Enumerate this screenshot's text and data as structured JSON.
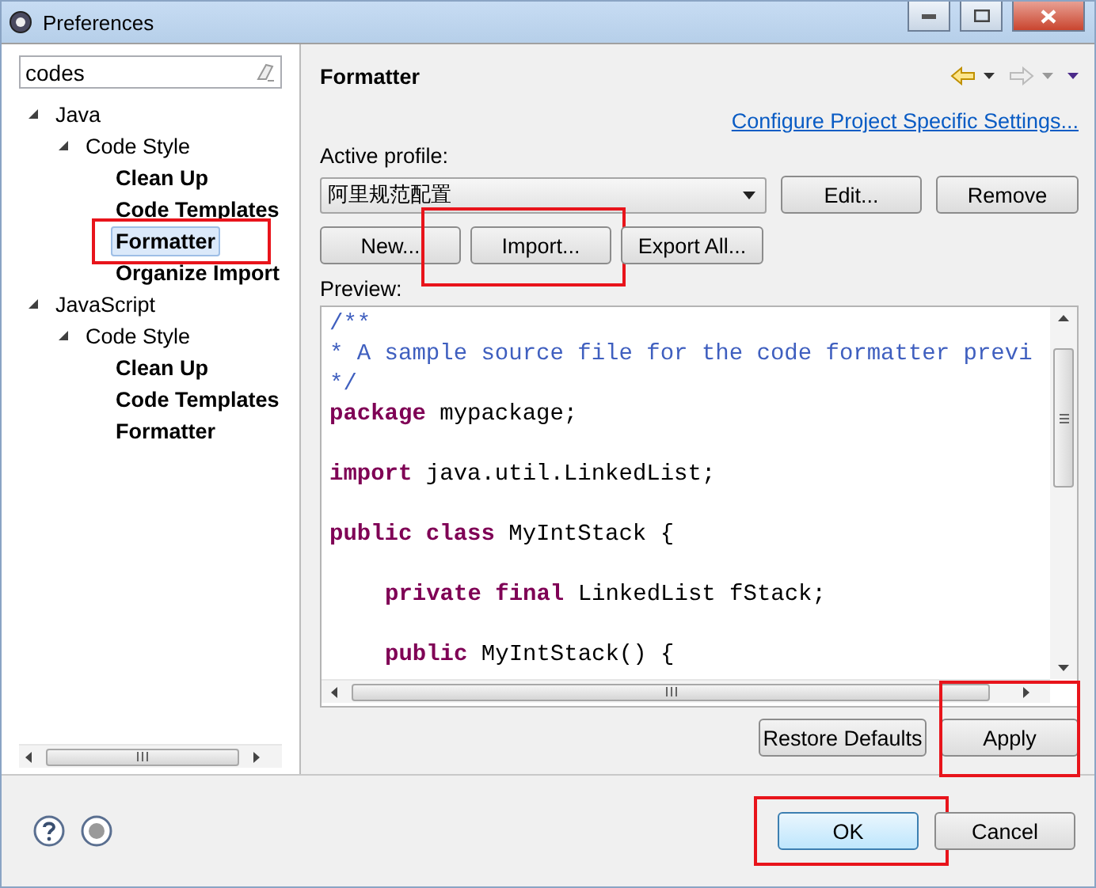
{
  "window": {
    "title": "Preferences"
  },
  "filter": {
    "value": "codes"
  },
  "tree": [
    {
      "label": "Java",
      "expanded": true,
      "children": [
        {
          "label": "Code Style",
          "expanded": true,
          "children": [
            {
              "label": "Clean Up",
              "selected": false,
              "annotated": false
            },
            {
              "label": "Code Templates",
              "selected": false,
              "annotated": false
            },
            {
              "label": "Formatter",
              "selected": true,
              "annotated": true
            },
            {
              "label": "Organize Import",
              "selected": false,
              "annotated": false
            }
          ]
        }
      ]
    },
    {
      "label": "JavaScript",
      "expanded": true,
      "children": [
        {
          "label": "Code Style",
          "expanded": true,
          "children": [
            {
              "label": "Clean Up",
              "selected": false,
              "annotated": false
            },
            {
              "label": "Code Templates",
              "selected": false,
              "annotated": false
            },
            {
              "label": "Formatter",
              "selected": false,
              "annotated": false
            }
          ]
        }
      ]
    }
  ],
  "page": {
    "title": "Formatter",
    "link": "Configure Project Specific Settings...",
    "profile_label": "Active profile:",
    "profile": "阿里规范配置",
    "profile_buttons": [
      {
        "label": "Edit...",
        "annotated": false
      },
      {
        "label": "Remove",
        "annotated": false
      }
    ],
    "buttons": [
      {
        "label": "New...",
        "annotated": false
      },
      {
        "label": "Import...",
        "annotated": true
      },
      {
        "label": "Export All...",
        "annotated": false
      }
    ],
    "preview_label": "Preview:",
    "preview": [
      {
        "kind": "line",
        "tokens": [
          {
            "kind": "comment",
            "text": "/**"
          }
        ]
      },
      {
        "kind": "line",
        "tokens": [
          {
            "kind": "comment",
            "text": "* A sample source file for the code formatter previ"
          }
        ]
      },
      {
        "kind": "line",
        "tokens": [
          {
            "kind": "comment",
            "text": "*/"
          }
        ]
      },
      {
        "kind": "line",
        "tokens": [
          {
            "kind": "keyword",
            "text": "package"
          },
          {
            "kind": "plain",
            "text": " mypackage;"
          }
        ]
      },
      {
        "kind": "blank"
      },
      {
        "kind": "line",
        "tokens": [
          {
            "kind": "keyword",
            "text": "import"
          },
          {
            "kind": "plain",
            "text": " java.util.LinkedList;"
          }
        ]
      },
      {
        "kind": "blank"
      },
      {
        "kind": "line",
        "tokens": [
          {
            "kind": "keyword",
            "text": "public class"
          },
          {
            "kind": "plain",
            "text": " MyIntStack {"
          }
        ]
      },
      {
        "kind": "blank"
      },
      {
        "kind": "indented",
        "tokens": [
          {
            "kind": "keyword",
            "text": "private final"
          },
          {
            "kind": "plain",
            "text": " LinkedList fStack;"
          }
        ]
      },
      {
        "kind": "blank"
      },
      {
        "kind": "indented",
        "tokens": [
          {
            "kind": "keyword",
            "text": "public"
          },
          {
            "kind": "plain",
            "text": " MyIntStack() {"
          }
        ]
      }
    ],
    "actions": [
      {
        "label": "Restore Defaults",
        "annotated": false
      },
      {
        "label": "Apply",
        "annotated": true
      }
    ]
  },
  "footer": {
    "buttons": [
      {
        "label": "OK",
        "default": true,
        "annotated": true
      },
      {
        "label": "Cancel",
        "default": false,
        "annotated": false
      }
    ]
  }
}
